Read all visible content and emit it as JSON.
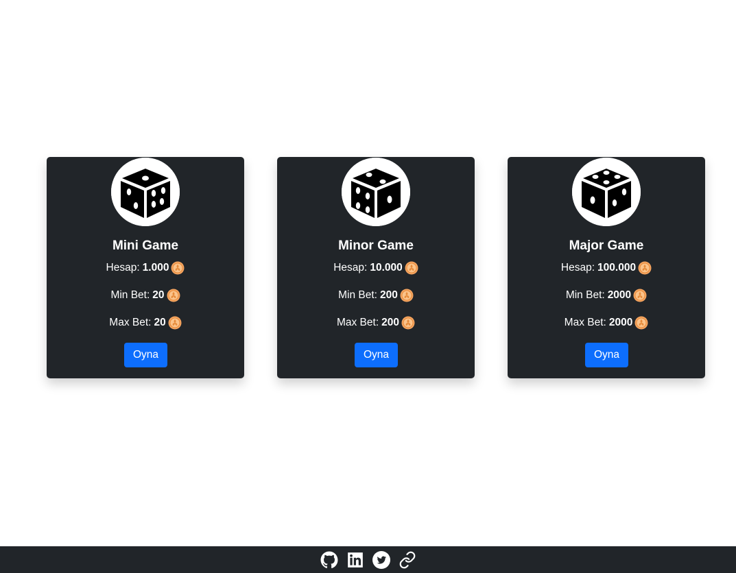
{
  "cards": [
    {
      "title": "Mini Game",
      "icon": "dice-icon",
      "lines": [
        {
          "label": "Hesap:",
          "value": "1.000"
        },
        {
          "label": "Min Bet:",
          "value": "20"
        },
        {
          "label": "Max Bet:",
          "value": "20"
        }
      ],
      "button": "Oyna"
    },
    {
      "title": "Minor Game",
      "icon": "dice-icon",
      "lines": [
        {
          "label": "Hesap:",
          "value": "10.000"
        },
        {
          "label": "Min Bet:",
          "value": "200"
        },
        {
          "label": "Max Bet:",
          "value": "200"
        }
      ],
      "button": "Oyna"
    },
    {
      "title": "Major Game",
      "icon": "dice-icon",
      "lines": [
        {
          "label": "Hesap:",
          "value": "100.000"
        },
        {
          "label": "Min Bet:",
          "value": "2000"
        },
        {
          "label": "Max Bet:",
          "value": "2000"
        }
      ],
      "button": "Oyna"
    }
  ],
  "footer": {
    "icons": [
      "github-icon",
      "linkedin-icon",
      "twitter-icon",
      "link-icon"
    ]
  },
  "colors": {
    "card_bg": "#212529",
    "button": "#0d6efd",
    "coin": "#f4a460",
    "footer_bg": "#212529"
  }
}
